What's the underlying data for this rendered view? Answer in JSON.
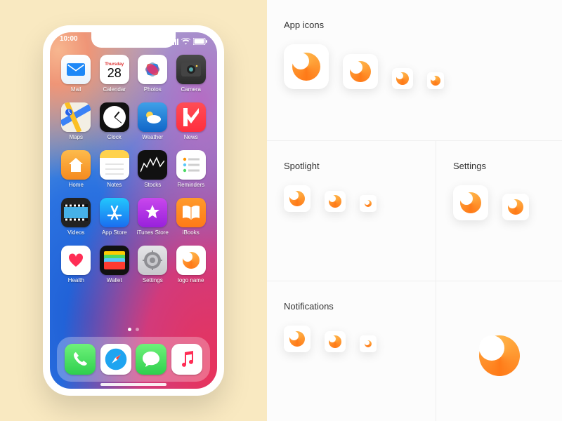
{
  "status": {
    "time": "10:00"
  },
  "calendar": {
    "weekday": "Thursday",
    "day": "28"
  },
  "apps": {
    "mail": "Mail",
    "calendar": "Calendar",
    "photos": "Photos",
    "camera": "Camera",
    "maps": "Maps",
    "clock": "Clock",
    "weather": "Weather",
    "news": "News",
    "home": "Home",
    "notes": "Notes",
    "stocks": "Stocks",
    "reminders": "Reminders",
    "videos": "Videos",
    "appstore": "App Store",
    "itunes": "iTunes Store",
    "ibooks": "iBooks",
    "health": "Health",
    "wallet": "Wallet",
    "settings": "Settings",
    "logo": "logo name"
  },
  "sections": {
    "appicons": "App icons",
    "spotlight": "Spotlight",
    "settings": "Settings",
    "notifications": "Notifications"
  },
  "colors": {
    "ring_start": "#ffb347",
    "ring_end": "#ff7a18",
    "cream": "#f9e9c1"
  }
}
